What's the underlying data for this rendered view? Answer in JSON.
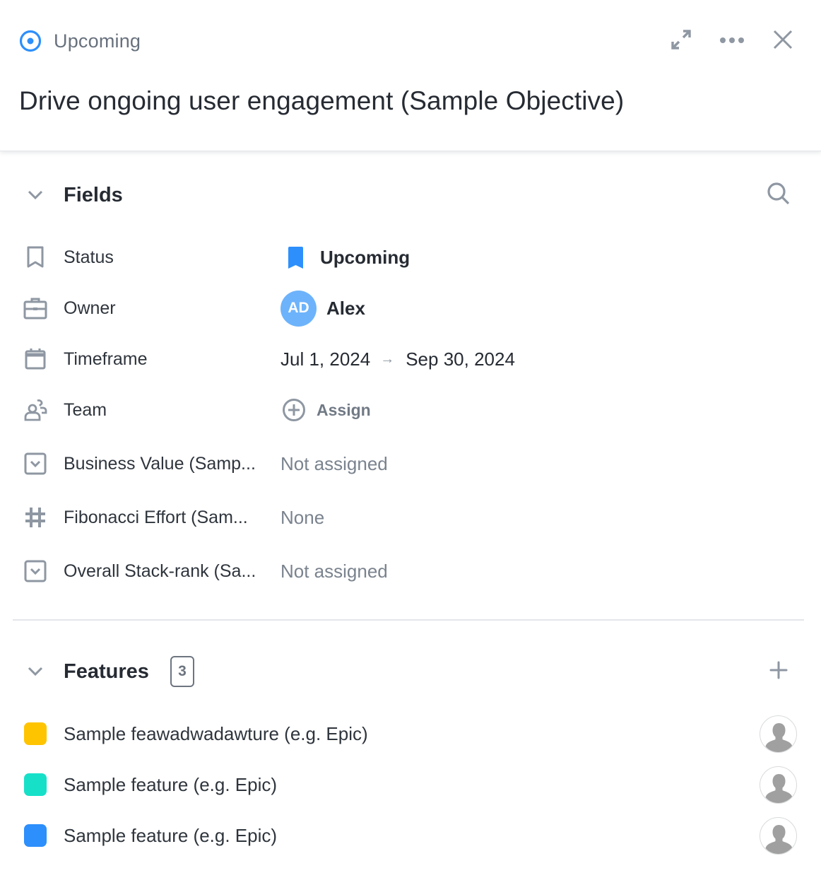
{
  "header": {
    "status_label": "Upcoming",
    "title": "Drive ongoing user engagement (Sample Objective)",
    "actions": [
      "expand-icon",
      "more-icon",
      "close-icon"
    ]
  },
  "fields_section": {
    "title": "Fields",
    "rows": [
      {
        "icon": "bookmark-icon",
        "label": "Status",
        "value": "Upcoming",
        "value_icon": "bookmark-filled-icon"
      },
      {
        "icon": "briefcase-icon",
        "label": "Owner",
        "value": "Alex",
        "avatar_initials": "AD"
      },
      {
        "icon": "calendar-icon",
        "label": "Timeframe",
        "start": "Jul 1, 2024",
        "arrow": "→",
        "end": "Sep 30, 2024"
      },
      {
        "icon": "team-icon",
        "label": "Team",
        "value": "Assign",
        "value_icon": "plus-circle-icon"
      },
      {
        "icon": "dropdown-field-icon",
        "label": "Business Value (Samp...",
        "value": "Not assigned"
      },
      {
        "icon": "hash-icon",
        "label": "Fibonacci Effort (Sam...",
        "value": "None"
      },
      {
        "icon": "dropdown-field-icon",
        "label": "Overall Stack-rank (Sa...",
        "value": "Not assigned"
      }
    ]
  },
  "features_section": {
    "title": "Features",
    "count": "3",
    "items": [
      {
        "label": "Sample feawadwadawture (e.g. Epic)",
        "color": "#ffc400"
      },
      {
        "label": "Sample feature (e.g. Epic)",
        "color": "#17e0c9"
      },
      {
        "label": "Sample feature (e.g. Epic)",
        "color": "#2d8ffb"
      }
    ]
  },
  "colors": {
    "accent": "#2d8ffb",
    "avatar": "#6db3fb",
    "icon_gray": "#8e97a2"
  }
}
